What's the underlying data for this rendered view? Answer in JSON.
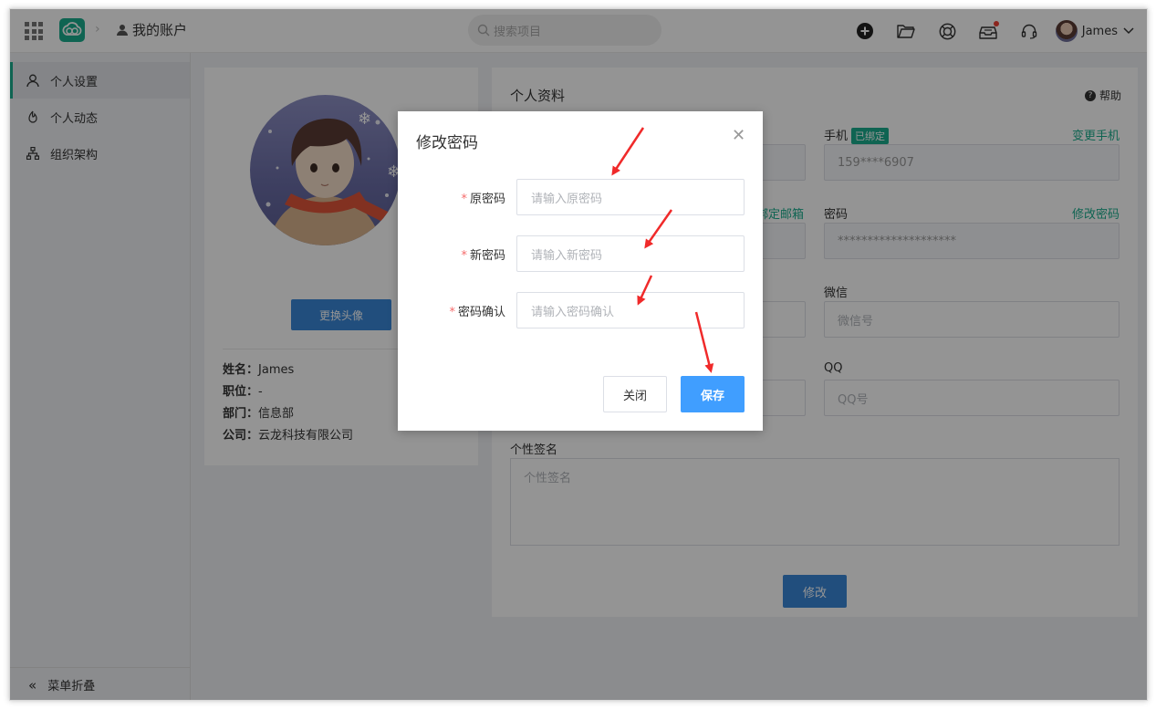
{
  "header": {
    "breadcrumb_title": "我的账户",
    "search_placeholder": "搜索项目",
    "username": "James"
  },
  "sidebar": {
    "items": [
      {
        "label": "个人设置",
        "active": true,
        "icon": "user-icon"
      },
      {
        "label": "个人动态",
        "active": false,
        "icon": "activity-icon"
      },
      {
        "label": "组织架构",
        "active": false,
        "icon": "org-chart-icon"
      }
    ],
    "collapse_label": "菜单折叠"
  },
  "profile": {
    "change_avatar_label": "更换头像",
    "name_label": "姓名：",
    "name_value": "James",
    "position_label": "职位：",
    "position_value": "-",
    "department_label": "部门：",
    "department_value": "信息部",
    "company_label": "公司：",
    "company_value": "云龙科技有限公司"
  },
  "details": {
    "title": "个人资料",
    "help_label": "帮助",
    "phone_label": "手机",
    "phone_badge": "已绑定",
    "phone_link": "变更手机",
    "phone_value": "159****6907",
    "email_link_partial": "绑定邮箱",
    "password_label": "密码",
    "password_link": "修改密码",
    "password_value": "********************",
    "wechat_label": "微信",
    "wechat_placeholder": "微信号",
    "qq_label": "QQ",
    "qq_placeholder": "QQ号",
    "signature_label": "个性签名",
    "signature_placeholder": "个性签名",
    "modify_label": "修改"
  },
  "dialog": {
    "title": "修改密码",
    "fields": [
      {
        "label": "原密码",
        "placeholder": "请输入原密码",
        "required": true
      },
      {
        "label": "新密码",
        "placeholder": "请输入新密码",
        "required": true
      },
      {
        "label": "密码确认",
        "placeholder": "请输入密码确认",
        "required": true
      }
    ],
    "close_label": "关闭",
    "save_label": "保存"
  },
  "colors": {
    "brand": "#1aad8d",
    "primary_button": "#409eff",
    "annotation_arrow": "#f02a2a"
  }
}
